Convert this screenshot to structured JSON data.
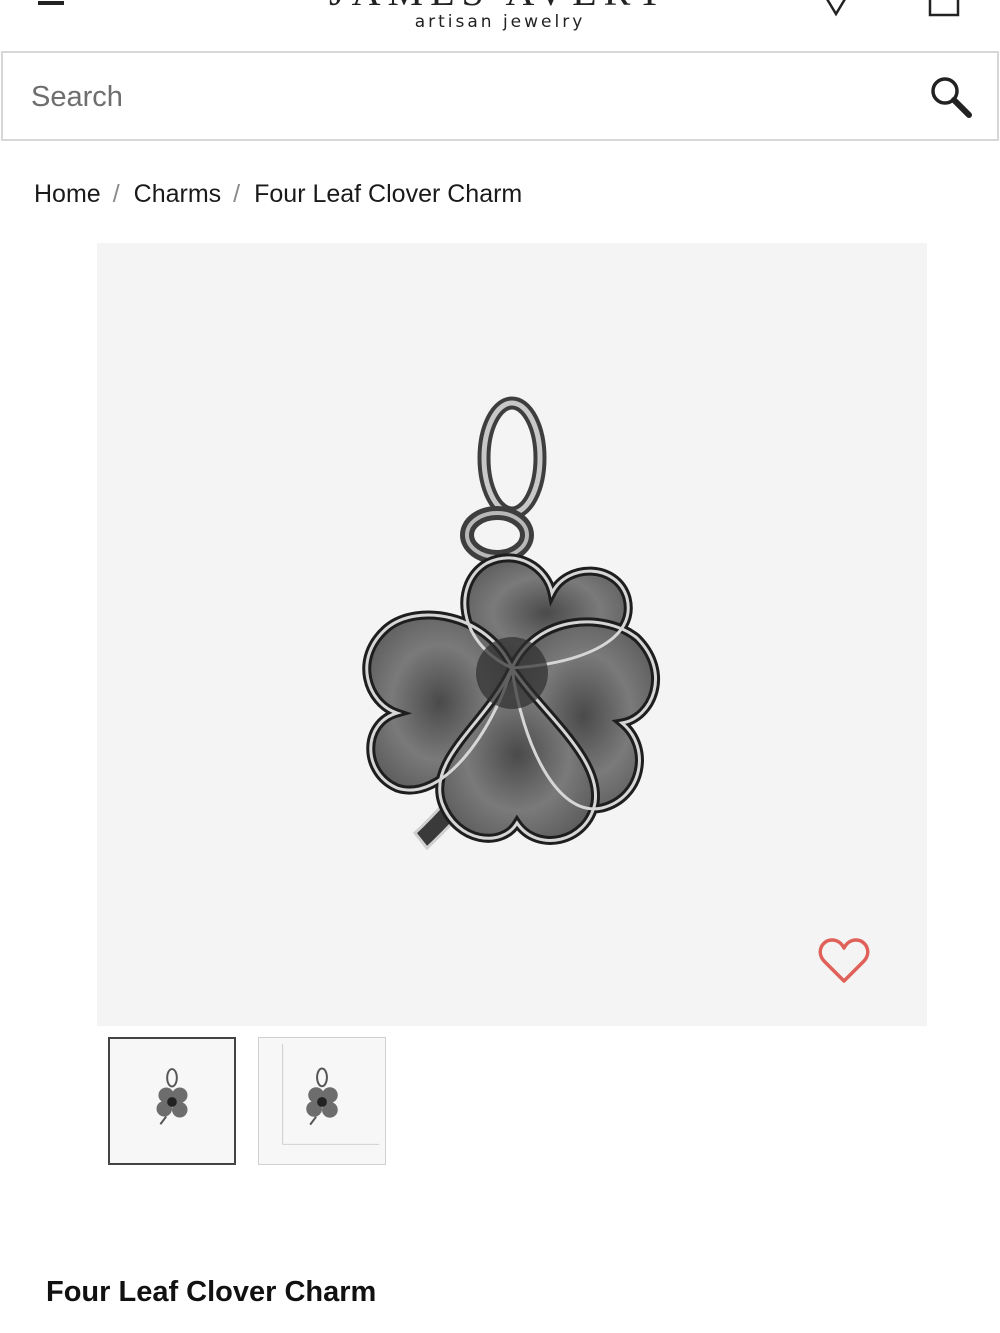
{
  "header": {
    "logo_main": "JAMES AVERY",
    "logo_sub": "artisan jewelry",
    "menu_icon": "hamburger-menu-icon",
    "location_icon": "location-pin-icon",
    "bag_icon": "shopping-bag-icon"
  },
  "search": {
    "placeholder": "Search",
    "icon": "search-icon"
  },
  "breadcrumb": {
    "items": [
      "Home",
      "Charms",
      "Four Leaf Clover Charm"
    ],
    "separator": "/"
  },
  "product": {
    "title": "Four Leaf Clover Charm",
    "wishlist_icon": "heart-icon",
    "wishlist_color": "#e0605a",
    "thumbnails": [
      "charm-front-thumbnail",
      "charm-size-chart-thumbnail"
    ]
  }
}
